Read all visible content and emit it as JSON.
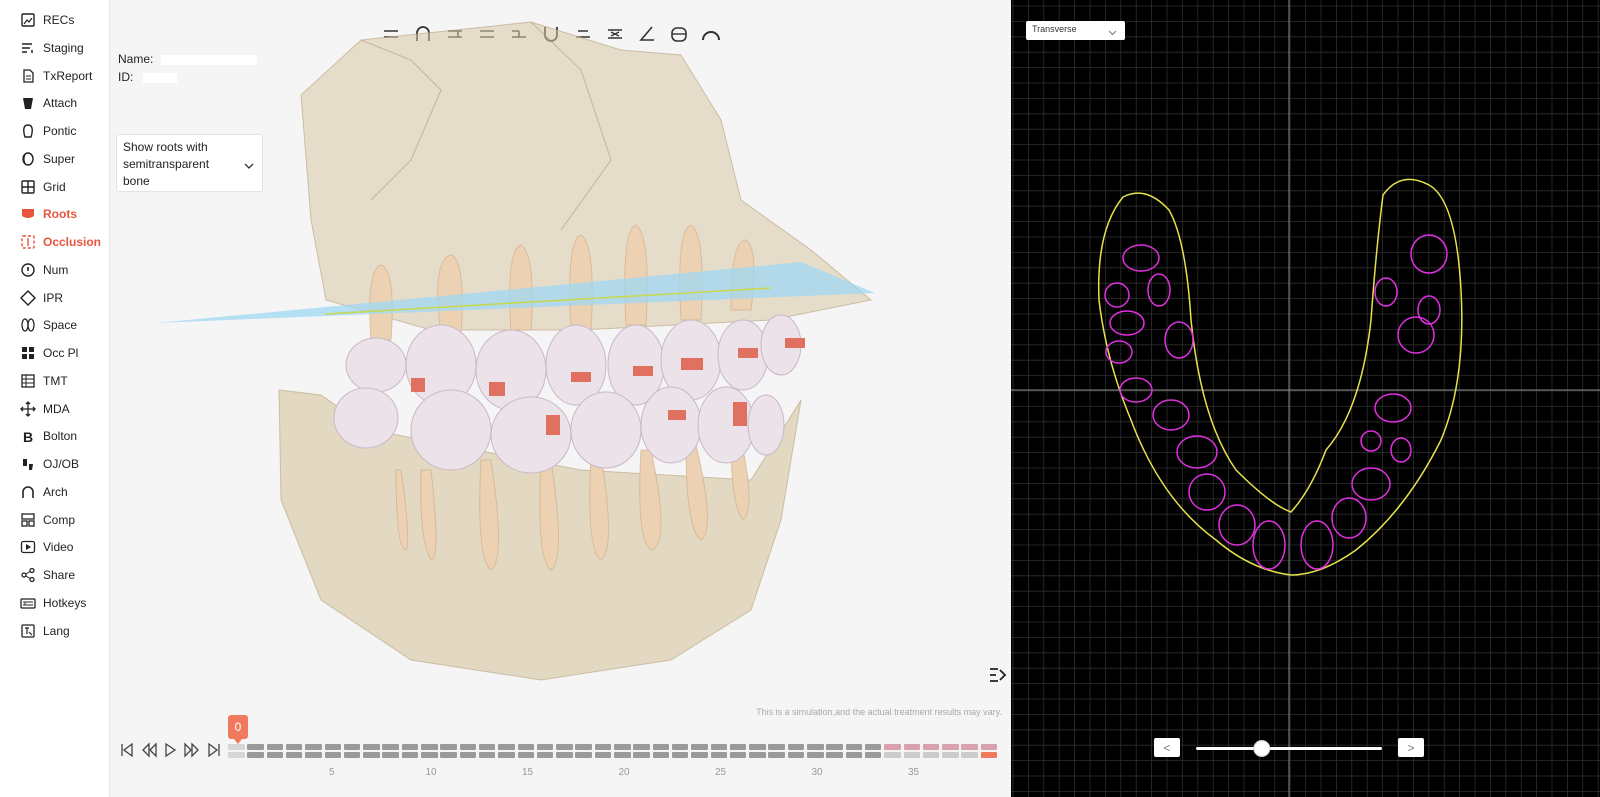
{
  "sidebar": {
    "items": [
      {
        "label": "RECs",
        "icon": "image-icon",
        "active": false
      },
      {
        "label": "Staging",
        "icon": "staging-list-icon",
        "active": false
      },
      {
        "label": "TxReport",
        "icon": "report-icon",
        "active": false
      },
      {
        "label": "Attach",
        "icon": "attachment-icon",
        "active": false
      },
      {
        "label": "Pontic",
        "icon": "pontic-icon",
        "active": false
      },
      {
        "label": "Super",
        "icon": "superimpose-icon",
        "active": false
      },
      {
        "label": "Grid",
        "icon": "grid-icon",
        "active": false
      },
      {
        "label": "Roots",
        "icon": "tooth-root-icon",
        "active": true
      },
      {
        "label": "Occlusion",
        "icon": "occlusion-icon",
        "active": true
      },
      {
        "label": "Num",
        "icon": "number-icon",
        "active": false
      },
      {
        "label": "IPR",
        "icon": "diamond-icon",
        "active": false
      },
      {
        "label": "Space",
        "icon": "space-icon",
        "active": false
      },
      {
        "label": "Occ Pl",
        "icon": "occlusal-plane-icon",
        "active": false
      },
      {
        "label": "TMT",
        "icon": "table-icon",
        "active": false
      },
      {
        "label": "MDA",
        "icon": "move-arrows-icon",
        "active": false
      },
      {
        "label": "Bolton",
        "icon": "bolton-icon",
        "active": false
      },
      {
        "label": "OJ/OB",
        "icon": "overjet-icon",
        "active": false
      },
      {
        "label": "Arch",
        "icon": "arch-icon",
        "active": false
      },
      {
        "label": "Comp",
        "icon": "compare-icon",
        "active": false
      },
      {
        "label": "Video",
        "icon": "play-icon",
        "active": false
      },
      {
        "label": "Share",
        "icon": "share-icon",
        "active": false
      },
      {
        "label": "Hotkeys",
        "icon": "keyboard-icon",
        "active": false
      },
      {
        "label": "Lang",
        "icon": "language-icon",
        "active": false
      }
    ]
  },
  "patient": {
    "name_label": "Name:",
    "id_label": "ID:"
  },
  "roots_dropdown": {
    "value": "Show roots with semitransparent bone"
  },
  "disclaimer": "This is a simulation,and the actual treatment results may vary.",
  "timeline": {
    "current_step": "0",
    "ticks": [
      "5",
      "10",
      "15",
      "20",
      "25",
      "30",
      "35"
    ],
    "total_steps": 40
  },
  "transverse": {
    "view_select": "Transverse",
    "prev_label": "<",
    "next_label": ">",
    "slider_position": 0.34
  },
  "colors": {
    "accent": "#e8553e",
    "bone": "#d8c6a8",
    "occlusal_plane": "#9fd8f3",
    "arch_outline": "#e6e24a",
    "root_section": "#e030e0",
    "grid": "#3a3a3a"
  }
}
